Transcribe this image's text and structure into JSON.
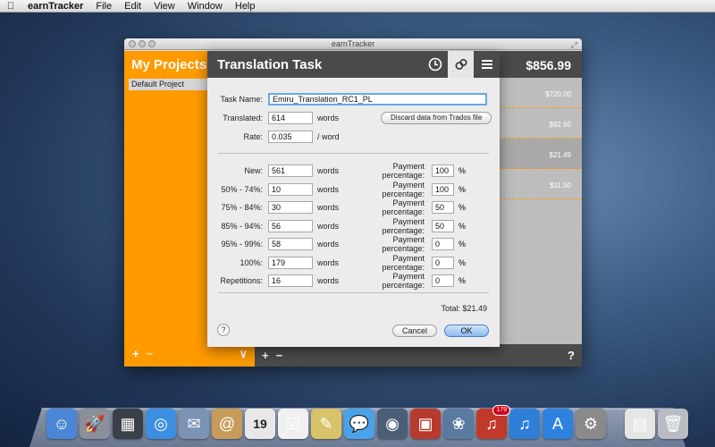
{
  "menubar": {
    "apple": "",
    "app_name": "earnTracker",
    "items": [
      "File",
      "Edit",
      "View",
      "Window",
      "Help"
    ]
  },
  "window": {
    "title": "earnTracker",
    "left": {
      "title": "My Projects",
      "projects": [
        "Default Project"
      ],
      "add": "+",
      "remove": "−",
      "collapse": "∨"
    },
    "right": {
      "total": "$856.99",
      "rows": [
        {
          "amount": "$720.00"
        },
        {
          "amount": "$92.50"
        },
        {
          "amount": "$21.49"
        },
        {
          "amount": "$11.50"
        }
      ],
      "add": "+",
      "remove": "−",
      "help": "?"
    }
  },
  "sheet": {
    "title": "Translation Task",
    "icons": [
      "clock-icon",
      "circles-icon",
      "menu-icon"
    ],
    "task_name_label": "Task Name:",
    "task_name_value": "Emiru_Translation_RC1_PL",
    "translated_label": "Translated:",
    "translated_value": "614",
    "translated_unit": "words",
    "discard_button": "Discard data from Trados file",
    "rate_label": "Rate:",
    "rate_value": "0.035",
    "rate_unit": "/ word",
    "payment_label": "Payment percentage:",
    "rows": [
      {
        "label": "New:",
        "words": "561",
        "unit": "words",
        "pct": "100",
        "pct_unit": "%"
      },
      {
        "label": "50% - 74%:",
        "words": "10",
        "unit": "words",
        "pct": "100",
        "pct_unit": "%"
      },
      {
        "label": "75% - 84%:",
        "words": "30",
        "unit": "words",
        "pct": "50",
        "pct_unit": "%"
      },
      {
        "label": "85% - 94%:",
        "words": "56",
        "unit": "words",
        "pct": "50",
        "pct_unit": "%"
      },
      {
        "label": "95% - 99%:",
        "words": "58",
        "unit": "words",
        "pct": "0",
        "pct_unit": "%"
      },
      {
        "label": "100%:",
        "words": "179",
        "unit": "words",
        "pct": "0",
        "pct_unit": "%"
      },
      {
        "label": "Repetitions:",
        "words": "16",
        "unit": "words",
        "pct": "0",
        "pct_unit": "%"
      }
    ],
    "total": "Total: $21.49",
    "help": "?",
    "cancel": "Cancel",
    "ok": "OK"
  },
  "dock": {
    "icons": [
      "finder-icon",
      "launchpad-icon",
      "mission-control-icon",
      "safari-icon",
      "mail-icon",
      "contacts-icon",
      "calendar-icon",
      "reminders-icon",
      "notes-icon",
      "messages-icon",
      "facetime-icon",
      "photo-booth-icon",
      "iphoto-icon",
      "itunes-store-icon",
      "itunes-icon",
      "app-store-icon",
      "system-preferences-icon",
      "documents-icon",
      "trash-icon"
    ],
    "calendar_day": "19",
    "badge": "179"
  }
}
